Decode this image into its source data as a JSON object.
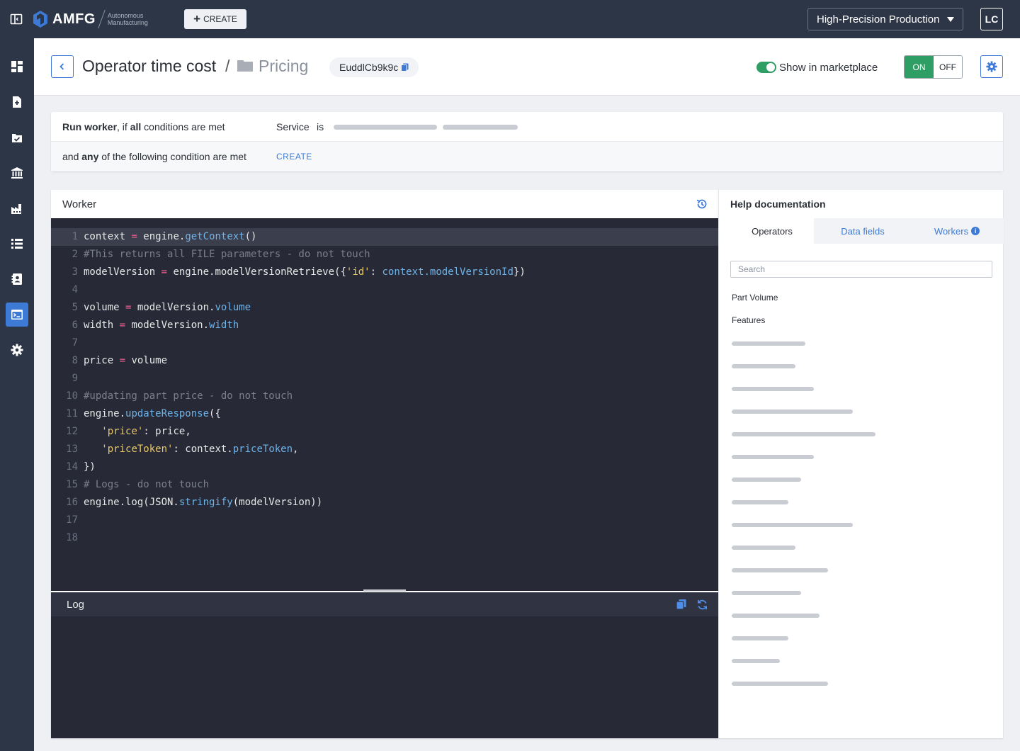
{
  "topbar": {
    "brand": "AMFG",
    "brand_sub": "Autonomous Manufacturing",
    "create_label": "CREATE",
    "production_select": "High-Precision Production",
    "avatar_initials": "LC"
  },
  "header": {
    "title": "Operator time cost",
    "separator": "/",
    "folder": "Pricing",
    "id_chip": "EuddlCb9k9c",
    "marketplace_label": "Show in marketplace",
    "marketplace_on": true,
    "on_label": "ON",
    "off_label": "OFF"
  },
  "conditions": {
    "row1": {
      "prefix": "Run worker",
      "mid": ", if ",
      "bold": "all",
      "suffix": " conditions are met",
      "field": "Service",
      "operator": "is"
    },
    "row2": {
      "prefix": "and ",
      "bold": "any",
      "suffix": " of the following condition are met",
      "create_label": "CREATE"
    }
  },
  "worker": {
    "title": "Worker",
    "log_title": "Log",
    "code": [
      "context = engine.getContext()",
      "#This returns all FILE parameters - do not touch",
      "modelVersion = engine.modelVersionRetrieve({'id': context.modelVersionId})",
      "",
      "volume = modelVersion.volume",
      "width = modelVersion.width",
      "",
      "price = volume",
      "",
      "#updating part price - do not touch",
      "engine.updateResponse({",
      "   'price': price,",
      "   'priceToken': context.priceToken,",
      "})",
      "# Logs - do not touch",
      "engine.log(JSON.stringify(modelVersion))",
      "",
      ""
    ],
    "active_line": 1
  },
  "help": {
    "title": "Help documentation",
    "tabs": [
      {
        "label": "Operators",
        "active": true
      },
      {
        "label": "Data fields",
        "active": false
      },
      {
        "label": "Workers",
        "active": false
      }
    ],
    "search_placeholder": "Search",
    "items": [
      "Part Volume",
      "Features"
    ]
  },
  "colors": {
    "topbar": "#2d3646",
    "accent": "#3d7ad6",
    "success": "#2f9e64",
    "editor_bg": "#272a36"
  }
}
